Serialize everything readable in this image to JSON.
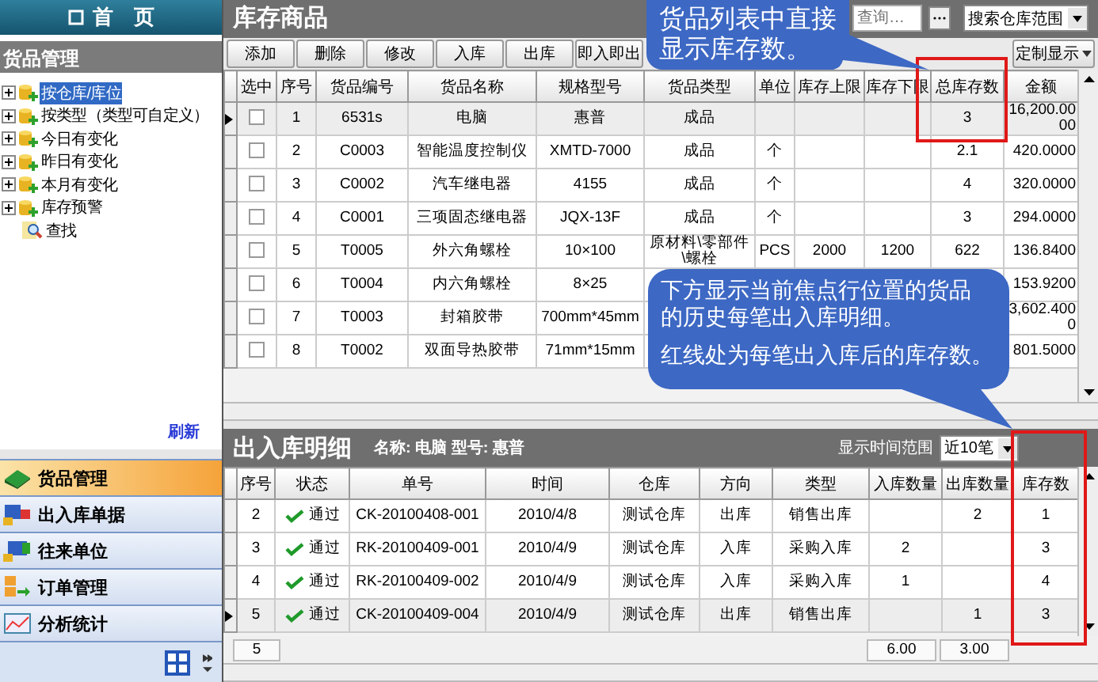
{
  "sidebar": {
    "home": "首　页",
    "section_title": "货品管理",
    "tree": [
      {
        "label": "按仓库/库位",
        "expanded": false,
        "selected": true
      },
      {
        "label": "按类型（类型可自定义）",
        "expanded": false,
        "selected": false
      },
      {
        "label": "今日有变化",
        "expanded": false,
        "selected": false
      },
      {
        "label": "昨日有变化",
        "expanded": false,
        "selected": false
      },
      {
        "label": "本月有变化",
        "expanded": false,
        "selected": false
      },
      {
        "label": "库存预警",
        "expanded": false,
        "selected": false
      },
      {
        "label": "查找",
        "selected": false
      }
    ],
    "refresh": "刷新",
    "nav": [
      {
        "label": "货品管理",
        "selected": true
      },
      {
        "label": "出入库单据",
        "selected": false
      },
      {
        "label": "往来单位",
        "selected": false
      },
      {
        "label": "订单管理",
        "selected": false
      },
      {
        "label": "分析统计",
        "selected": false
      }
    ]
  },
  "goods": {
    "title": "库存商品",
    "search": {
      "placeholder": "查询…"
    },
    "scope": "搜索仓库范围",
    "toolbar": [
      "添加",
      "删除",
      "修改",
      "入库",
      "出库",
      "即入即出"
    ],
    "custom": "定制显示",
    "columns": [
      "选中",
      "序号",
      "货品编号",
      "货品名称",
      "规格型号",
      "货品类型",
      "单位",
      "库存上限",
      "库存下限",
      "总库存数",
      "金额"
    ],
    "rows": [
      {
        "current": true,
        "checked": false,
        "no": "1",
        "code": "6531s",
        "name": "电脑",
        "spec": "惠普",
        "type": "成品",
        "stock": "3",
        "amount": "16,200.0000"
      },
      {
        "current": false,
        "checked": false,
        "no": "2",
        "code": "C0003",
        "name": "智能温度控制仪",
        "spec": "XMTD-7000",
        "type": "成品",
        "unit": "个",
        "stock": "2.1",
        "amount": "420.0000"
      },
      {
        "current": false,
        "checked": false,
        "no": "3",
        "code": "C0002",
        "name": "汽车继电器",
        "spec": "4155",
        "type": "成品",
        "unit": "个",
        "stock": "4",
        "amount": "320.0000"
      },
      {
        "current": false,
        "checked": false,
        "no": "4",
        "code": "C0001",
        "name": "三项固态继电器",
        "spec": "JQX-13F",
        "type": "成品",
        "unit": "个",
        "stock": "3",
        "amount": "294.0000"
      },
      {
        "current": false,
        "checked": false,
        "no": "5",
        "code": "T0005",
        "name": "外六角螺栓",
        "spec": "10×100",
        "type": "原材料\\零部件\\螺栓",
        "unit": "PCS",
        "upper": "2000",
        "lower": "1200",
        "stock": "622",
        "amount": "136.8400"
      },
      {
        "current": false,
        "checked": false,
        "no": "6",
        "code": "T0004",
        "name": "内六角螺栓",
        "spec": "8×25",
        "amount": "153.9200"
      },
      {
        "current": false,
        "checked": false,
        "no": "7",
        "code": "T0003",
        "name": "封箱胶带",
        "spec": "700mm*45mm",
        "amount": "3,602.4000"
      },
      {
        "current": false,
        "checked": false,
        "no": "8",
        "code": "T0002",
        "name": "双面导热胶带",
        "spec": "71mm*15mm",
        "amount": "801.5000"
      }
    ]
  },
  "details": {
    "title": "出入库明细",
    "subject": "名称: 电脑 型号: 惠普",
    "range_label": "显示时间范围",
    "range": "近10笔",
    "columns": [
      "序号",
      "状态",
      "单号",
      "时间",
      "仓库",
      "方向",
      "类型",
      "入库数量",
      "出库数量",
      "库存数"
    ],
    "rows": [
      {
        "current": false,
        "cells": [
          "2",
          "通过",
          "CK-20100408-001",
          "2010/4/8",
          "测试仓库",
          "出库",
          "销售出库",
          "",
          "2",
          "1"
        ]
      },
      {
        "current": false,
        "cells": [
          "3",
          "通过",
          "RK-20100409-001",
          "2010/4/9",
          "测试仓库",
          "入库",
          "采购入库",
          "2",
          "",
          "3"
        ]
      },
      {
        "current": false,
        "cells": [
          "4",
          "通过",
          "RK-20100409-002",
          "2010/4/9",
          "测试仓库",
          "入库",
          "采购入库",
          "1",
          "",
          "4"
        ]
      },
      {
        "current": true,
        "cells": [
          "5",
          "通过",
          "CK-20100409-004",
          "2010/4/9",
          "测试仓库",
          "出库",
          "销售出库",
          "",
          "1",
          "3"
        ]
      }
    ],
    "count": "5",
    "total_in": "6.00",
    "total_out": "3.00"
  },
  "callouts": [
    {
      "lines": [
        "货品列表中直接",
        "显示库存数。"
      ]
    },
    {
      "lines": [
        "下方显示当前焦点行位置的货品",
        "的历史每笔出入库明细。"
      ],
      "note": "红线处为每笔出入库后的库存数。"
    }
  ]
}
